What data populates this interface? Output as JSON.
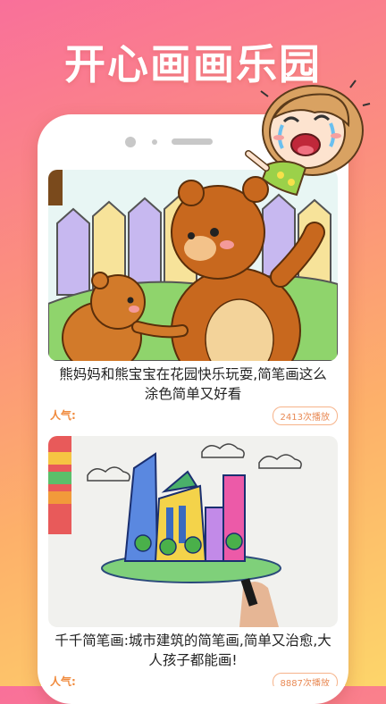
{
  "promo": {
    "title": "开心画画乐园"
  },
  "cards": [
    {
      "title": "熊妈妈和熊宝宝在花园快乐玩耍,简笔画这么涂色简单又好看",
      "popularity_label": "人气:",
      "plays": "2413次播放"
    },
    {
      "title": "千千简笔画:城市建筑的简笔画,简单又治愈,大人孩子都能画!",
      "popularity_label": "人气:",
      "plays": "8887次播放"
    }
  ]
}
